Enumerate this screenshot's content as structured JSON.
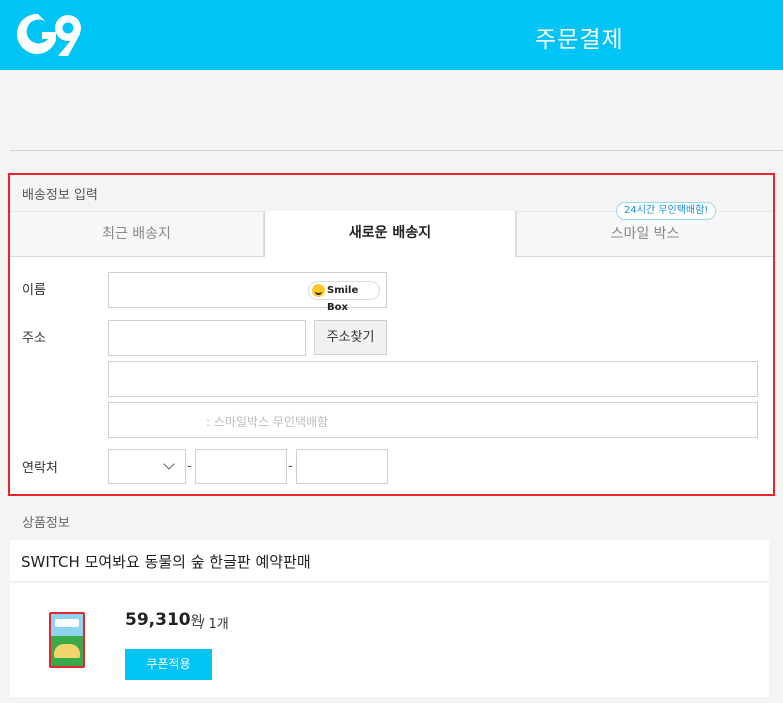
{
  "header": {
    "logo_text": "G9",
    "title": "주문결제"
  },
  "shipping": {
    "section_title": "배송정보 입력",
    "tabs": [
      {
        "label": "최근 배송지",
        "active": false
      },
      {
        "label": "새로운 배송지",
        "active": true
      },
      {
        "label": "스마일 박스",
        "active": false
      }
    ],
    "smilebox_badge": "24시간 무인택배함!",
    "name_label": "이름",
    "smilebox_logo_text": "Smile Box",
    "address_label": "주소",
    "address_search_button": "주소찾기",
    "address_hint": ": 스마일박스 무인택배함",
    "contact_label": "연락처",
    "dash": "-"
  },
  "product": {
    "section_title": "상품정보",
    "name": "SWITCH 모여봐요 동물의 숲 한글판 예약판매",
    "price": "59,310",
    "price_unit": "원",
    "quantity": "/ 1개",
    "coupon_button": "쿠폰적용"
  },
  "colors": {
    "brand": "#00c3f6",
    "highlight_border": "#e8242d"
  }
}
